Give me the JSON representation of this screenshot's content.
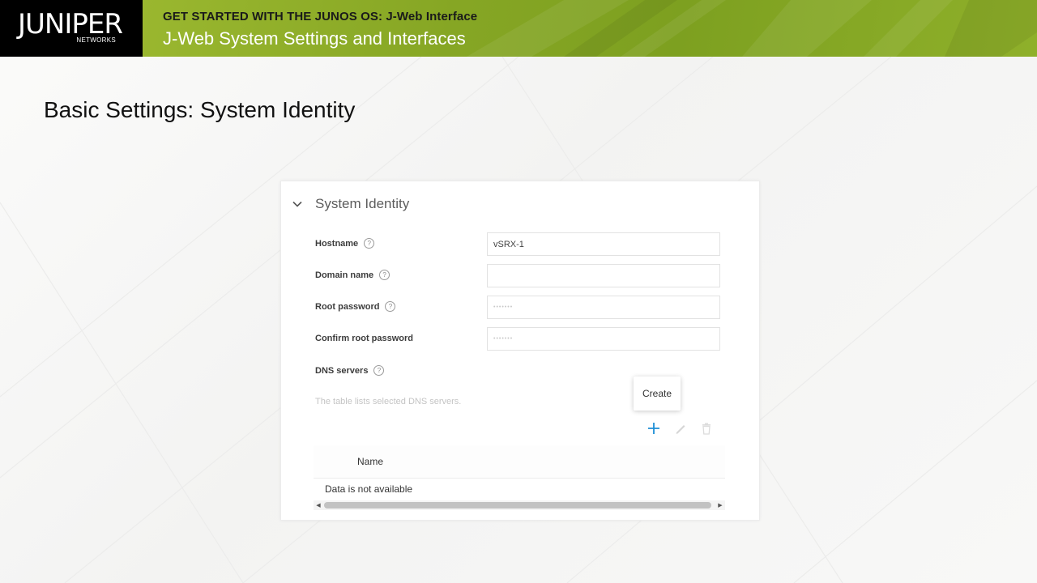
{
  "banner": {
    "logo_text": "JUNIPER",
    "logo_subtext": "NETWORKS",
    "subtitle": "GET STARTED WITH THE JUNOS OS: J-Web Interface",
    "title": "J-Web System Settings and Interfaces",
    "colors": {
      "logo_bg": "#000000",
      "band": "#86a624"
    }
  },
  "page_heading": "Basic Settings: System Identity",
  "panel": {
    "section_title": "System Identity",
    "section_icon": "chevron-down-icon",
    "fields": {
      "hostname": {
        "label": "Hostname",
        "value": "vSRX-1"
      },
      "domain_name": {
        "label": "Domain name",
        "value": ""
      },
      "root_password": {
        "label": "Root password",
        "value": "•••••••"
      },
      "confirm_root_password": {
        "label": "Confirm root password",
        "value": "•••••••"
      },
      "dns_servers": {
        "label": "DNS servers"
      }
    },
    "dns_helper_text": "The table lists selected DNS servers.",
    "tooltip": "Create",
    "toolbar_icons": [
      "plus-icon",
      "pencil-icon",
      "trash-icon"
    ],
    "table": {
      "columns": [
        "Name"
      ],
      "empty_message": "Data is not available"
    },
    "accent_color": "#1e8fd6"
  }
}
